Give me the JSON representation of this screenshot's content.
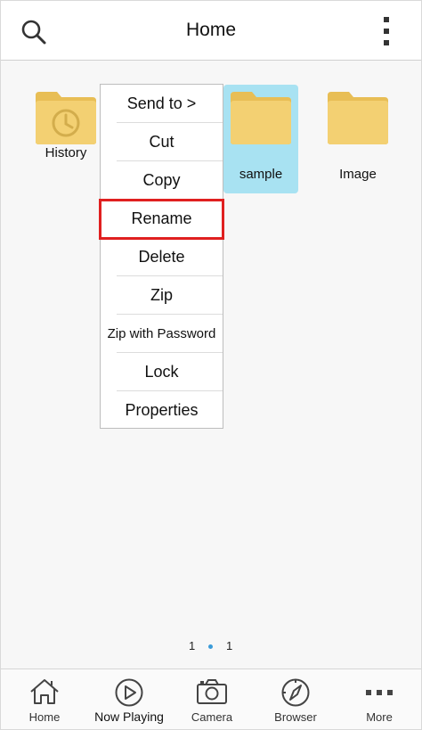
{
  "header": {
    "title": "Home",
    "search_icon": "search-icon",
    "menu_icon": "vertical-ellipsis-icon"
  },
  "folders": [
    {
      "label": "History",
      "icon": "clock-folder-icon",
      "selected": false
    },
    {
      "label": "sample",
      "icon": "folder-icon",
      "selected": true
    },
    {
      "label": "Image",
      "icon": "folder-icon",
      "selected": false
    }
  ],
  "context_menu": {
    "items": [
      {
        "label": "Send to >"
      },
      {
        "label": "Cut"
      },
      {
        "label": "Copy"
      },
      {
        "label": "Rename",
        "highlighted": true
      },
      {
        "label": "Delete"
      },
      {
        "label": "Zip"
      },
      {
        "label": "Zip with Password"
      },
      {
        "label": "Lock"
      },
      {
        "label": "Properties"
      }
    ]
  },
  "pager": {
    "left": "1",
    "right": "1"
  },
  "tabbar": {
    "tabs": [
      {
        "label": "Home",
        "icon": "home-icon"
      },
      {
        "label": "Now Playing",
        "icon": "play-icon",
        "active": true
      },
      {
        "label": "Camera",
        "icon": "camera-icon"
      },
      {
        "label": "Browser",
        "icon": "compass-icon"
      },
      {
        "label": "More",
        "icon": "more-dots-icon"
      }
    ]
  },
  "colors": {
    "selection": "#a8e2f2",
    "highlight_border": "#e02020",
    "folder": "#f2cf6b",
    "page_dot": "#3a9bd8"
  }
}
